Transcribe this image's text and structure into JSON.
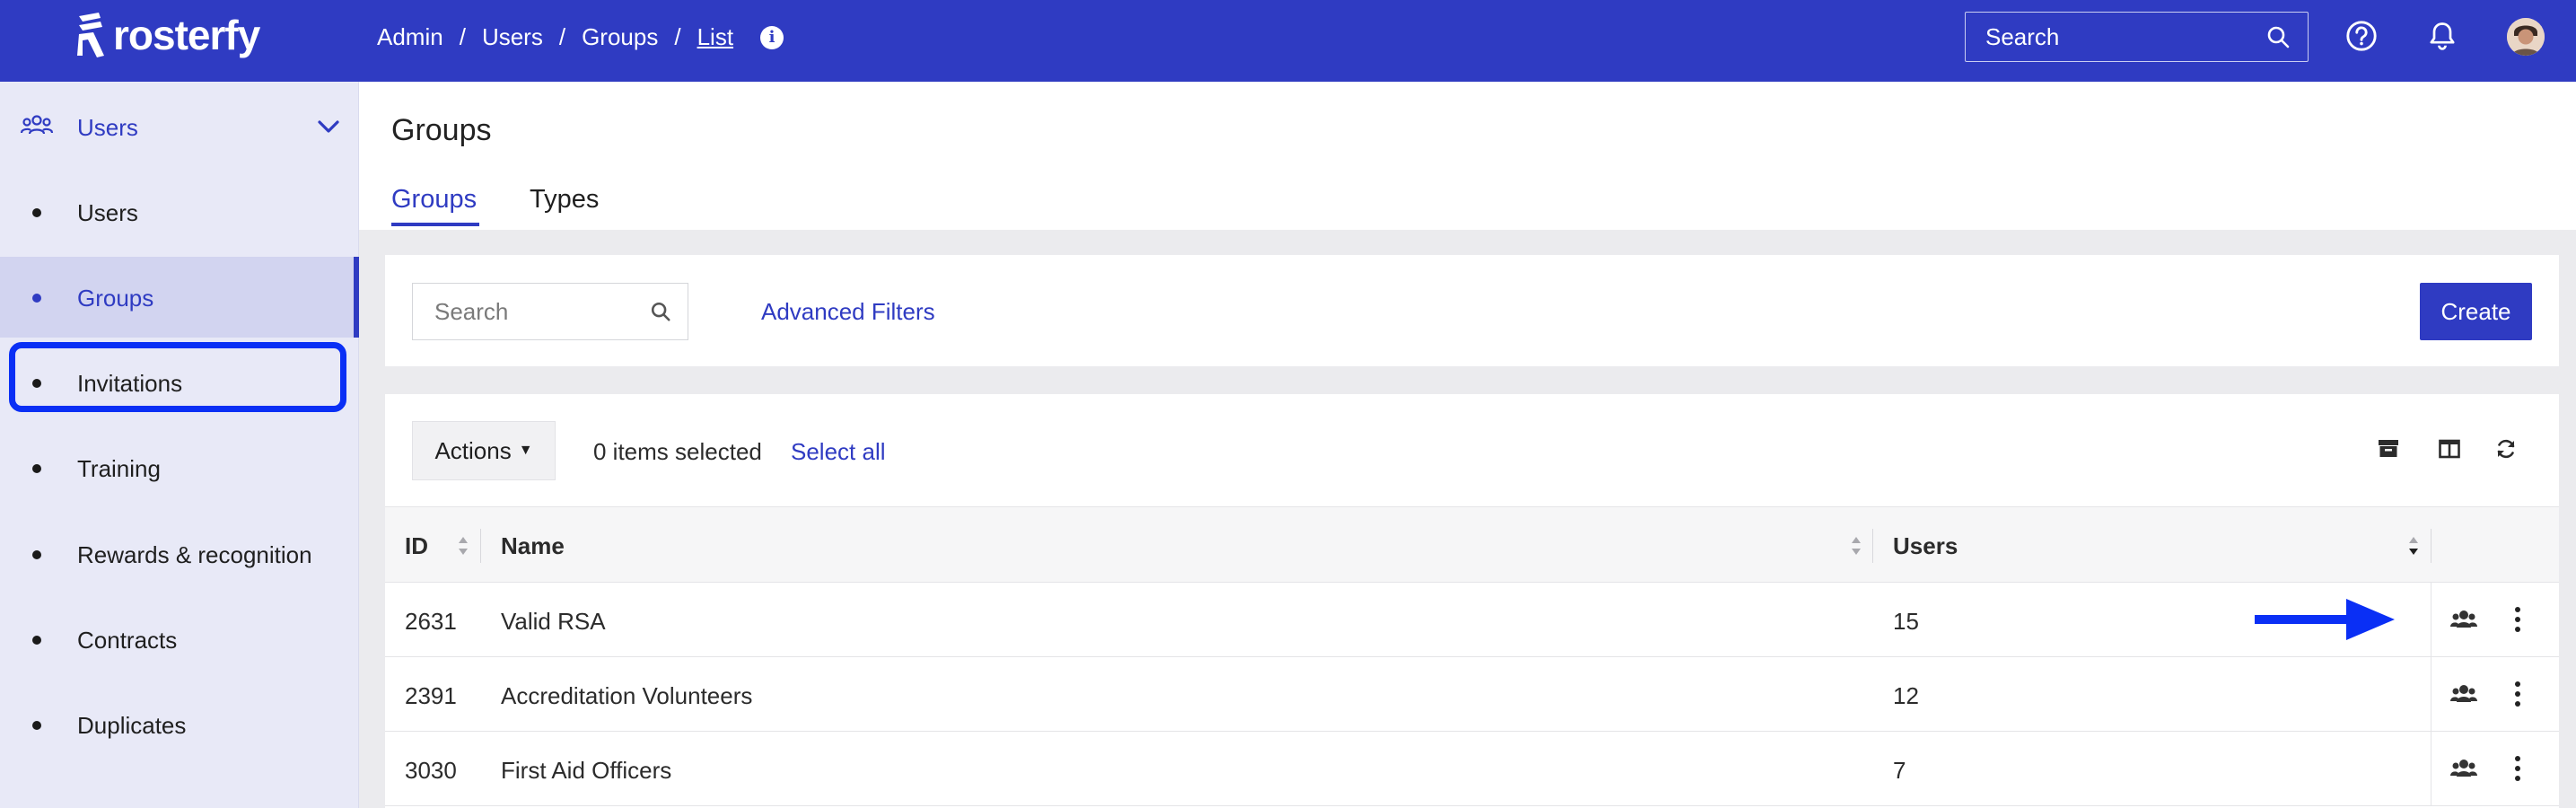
{
  "app": {
    "logo_text": "rosterfy"
  },
  "breadcrumb": {
    "items": [
      "Admin",
      "Users",
      "Groups"
    ],
    "current": "List",
    "separator": "/",
    "info_glyph": "i"
  },
  "header": {
    "search_placeholder": "Search"
  },
  "sidebar": {
    "section_label": "Users",
    "items": [
      {
        "label": "Users",
        "active": false
      },
      {
        "label": "Groups",
        "active": true
      },
      {
        "label": "Invitations",
        "active": false
      },
      {
        "label": "Training",
        "active": false
      },
      {
        "label": "Rewards & recognition",
        "active": false
      },
      {
        "label": "Contracts",
        "active": false
      },
      {
        "label": "Duplicates",
        "active": false
      }
    ]
  },
  "page": {
    "title": "Groups",
    "tabs": [
      {
        "label": "Groups",
        "active": true
      },
      {
        "label": "Types",
        "active": false
      }
    ]
  },
  "filters": {
    "search_placeholder": "Search",
    "advanced_label": "Advanced Filters",
    "create_label": "Create"
  },
  "toolbar": {
    "actions_label": "Actions",
    "selected_text": "0 items selected",
    "select_all_label": "Select all"
  },
  "table": {
    "columns": [
      "ID",
      "Name",
      "Users"
    ],
    "rows": [
      {
        "id": "2631",
        "name": "Valid RSA",
        "users": "15"
      },
      {
        "id": "2391",
        "name": "Accreditation Volunteers",
        "users": "12"
      },
      {
        "id": "3030",
        "name": "First Aid Officers",
        "users": "7"
      }
    ]
  },
  "colors": {
    "brand": "#2f3bc2",
    "highlight": "#0a2ff5",
    "sidebar_bg": "#e8e9f7"
  },
  "icons": [
    "search-icon",
    "help-icon",
    "bell-icon",
    "users-group-icon",
    "chevron-down-icon",
    "archive-icon",
    "columns-icon",
    "refresh-icon",
    "more-vertical-icon",
    "arrow-annotation"
  ]
}
